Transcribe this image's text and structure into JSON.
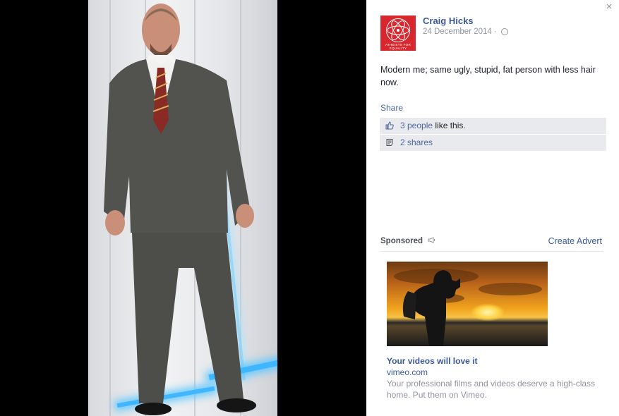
{
  "close_glyph": "×",
  "post": {
    "author": "Craig Hicks",
    "date": "24 December 2014",
    "separator": "·",
    "audience_icon": "globe-icon",
    "text": "Modern me; same ugly, stupid, fat person with less hair now.",
    "avatar_text": "ATHEISTS FOR EQUALITY",
    "share_label": "Share",
    "likes": {
      "link": "3 people",
      "suffix": " like this."
    },
    "shares": {
      "link": "2 shares"
    }
  },
  "sidebar": {
    "sponsored_label": "Sponsored",
    "create_advert": "Create Advert",
    "ad": {
      "title": "Your videos will love it",
      "url": "vimeo.com",
      "description": "Your professional films and videos deserve a high-class home. Put them on Vimeo."
    }
  },
  "colors": {
    "link": "#3b5998",
    "avatar_bg": "#d7282f",
    "panel_bg": "#ffffff",
    "stage_bg": "#000000"
  }
}
